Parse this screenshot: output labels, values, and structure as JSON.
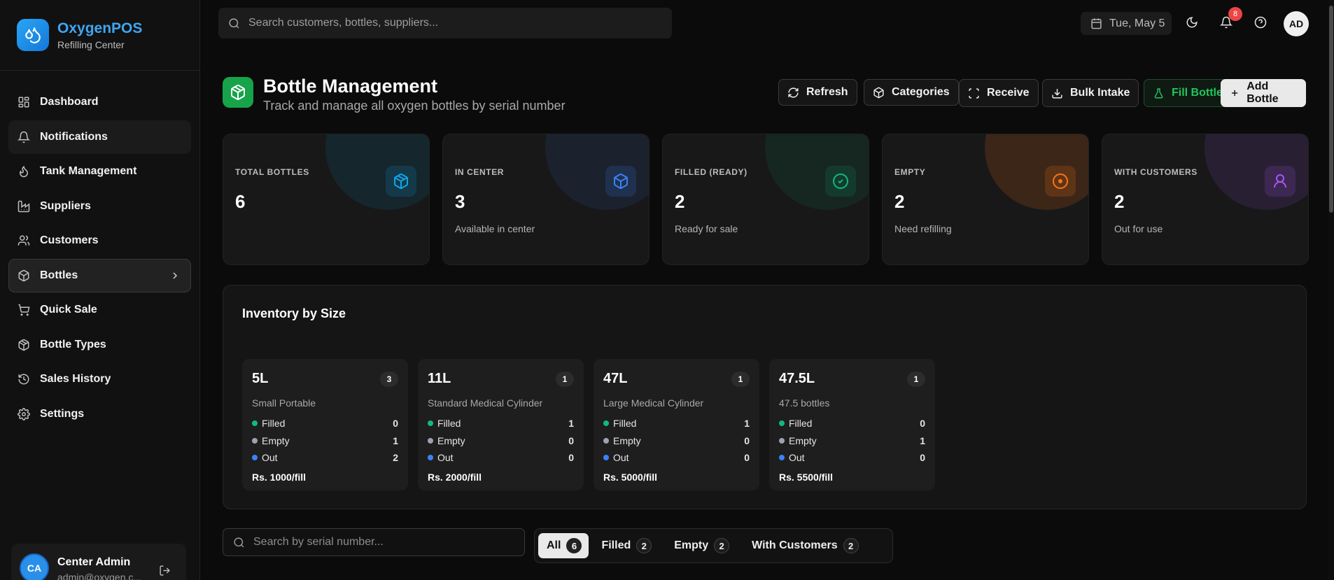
{
  "brand": {
    "name": "OxygenPOS",
    "subtitle": "Refilling Center",
    "icon": "droplet-icon"
  },
  "nav": [
    {
      "label": "Dashboard",
      "icon": "grid-icon"
    },
    {
      "label": "Notifications",
      "icon": "bell-icon"
    },
    {
      "label": "Tank Management",
      "icon": "flame-icon"
    },
    {
      "label": "Suppliers",
      "icon": "factory-icon"
    },
    {
      "label": "Customers",
      "icon": "users-icon"
    },
    {
      "label": "Bottles",
      "icon": "box-icon"
    },
    {
      "label": "Quick Sale",
      "icon": "cart-icon"
    },
    {
      "label": "Bottle Types",
      "icon": "package-icon"
    },
    {
      "label": "Sales History",
      "icon": "history-icon"
    },
    {
      "label": "Settings",
      "icon": "gear-icon"
    }
  ],
  "user": {
    "initials": "CA",
    "name": "Center Admin",
    "email": "admin@oxygen.c..."
  },
  "topbar": {
    "search_placeholder": "Search customers, bottles, suppliers...",
    "date": "Tue, May 5",
    "notifications_count": "8",
    "avatar_initials": "AD"
  },
  "page": {
    "title": "Bottle Management",
    "subtitle": "Track and manage all oxygen bottles by serial number"
  },
  "actions": {
    "refresh": "Refresh",
    "categories": "Categories",
    "receive": "Receive",
    "bulk_intake": "Bulk Intake",
    "fill_bottles": "Fill Bottles",
    "add_bottle": "Add Bottle"
  },
  "stats": [
    {
      "label": "TOTAL BOTTLES",
      "value": "6",
      "note": "",
      "color": "#0ea5e9"
    },
    {
      "label": "IN CENTER",
      "value": "3",
      "note": "Available in center",
      "color": "#3b82f6"
    },
    {
      "label": "FILLED (READY)",
      "value": "2",
      "note": "Ready for sale",
      "color": "#10b981"
    },
    {
      "label": "EMPTY",
      "value": "2",
      "note": "Need refilling",
      "color": "#f97316"
    },
    {
      "label": "WITH CUSTOMERS",
      "value": "2",
      "note": "Out for use",
      "color": "#a855f7"
    }
  ],
  "inventory": {
    "title": "Inventory by Size",
    "row_labels": {
      "filled": "Filled",
      "empty": "Empty",
      "out": "Out"
    },
    "sizes": [
      {
        "name": "5L",
        "count": "3",
        "desc": "Small Portable",
        "filled": "0",
        "empty": "1",
        "out": "2",
        "price": "Rs. 1000/fill"
      },
      {
        "name": "11L",
        "count": "1",
        "desc": "Standard Medical Cylinder",
        "filled": "1",
        "empty": "0",
        "out": "0",
        "price": "Rs. 2000/fill"
      },
      {
        "name": "47L",
        "count": "1",
        "desc": "Large Medical Cylinder",
        "filled": "1",
        "empty": "0",
        "out": "0",
        "price": "Rs. 5000/fill"
      },
      {
        "name": "47.5L",
        "count": "1",
        "desc": "47.5 bottles",
        "filled": "0",
        "empty": "1",
        "out": "0",
        "price": "Rs. 5500/fill"
      }
    ]
  },
  "filters": {
    "serial_placeholder": "Search by serial number...",
    "tabs": [
      {
        "label": "All",
        "count": "6"
      },
      {
        "label": "Filled",
        "count": "2"
      },
      {
        "label": "Empty",
        "count": "2"
      },
      {
        "label": "With Customers",
        "count": "2"
      }
    ]
  }
}
